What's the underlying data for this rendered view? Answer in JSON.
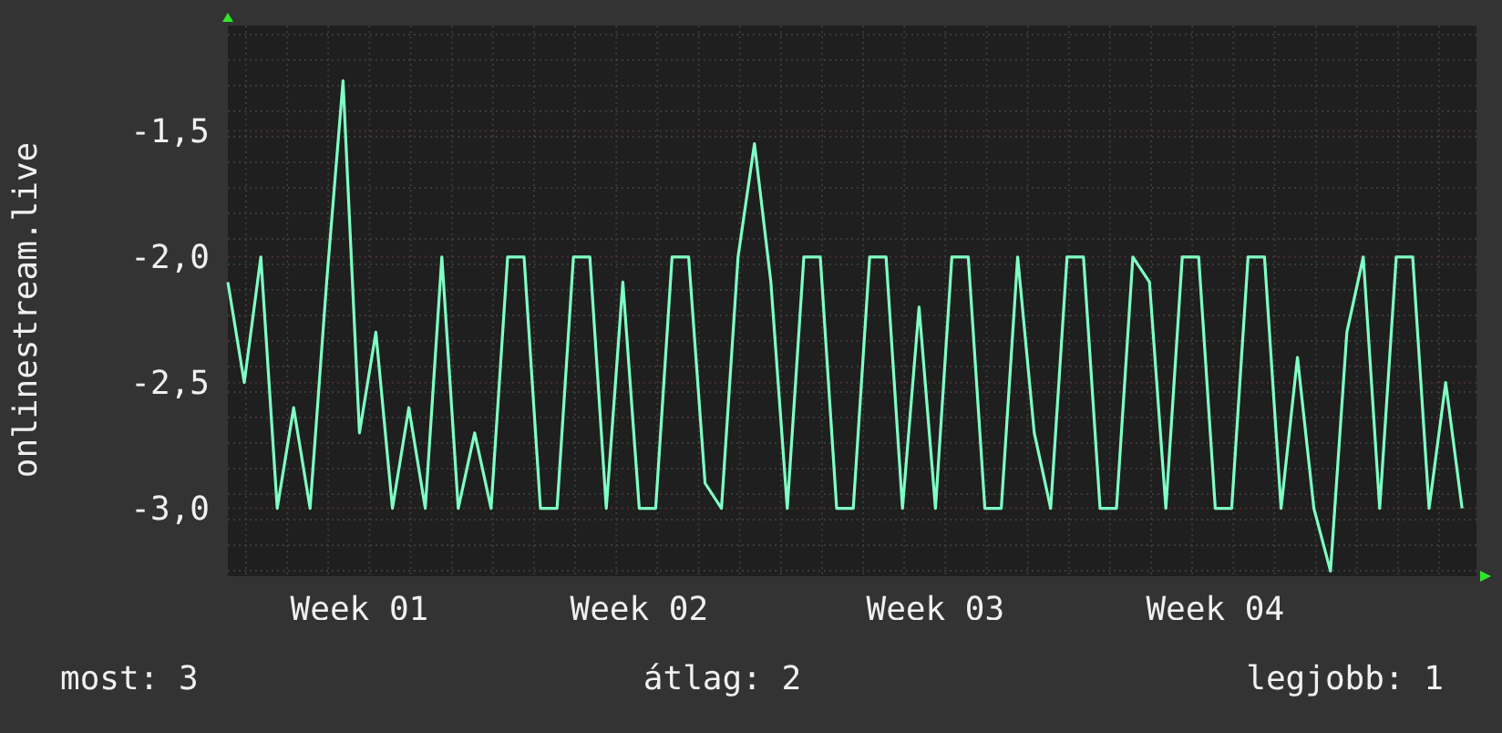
{
  "chart": {
    "chart_data": {
      "type": "line",
      "ylabel": "onlinestream.live",
      "grid": true,
      "ylim": [
        -3.27,
        -1.08
      ],
      "categories": [
        null,
        null,
        null,
        null,
        null,
        null,
        null,
        null,
        "Week 01",
        null,
        null,
        null,
        null,
        null,
        null,
        null,
        null,
        null,
        null,
        null,
        null,
        null,
        null,
        null,
        null,
        "Week 02",
        null,
        null,
        null,
        null,
        null,
        null,
        null,
        null,
        null,
        null,
        null,
        null,
        null,
        null,
        null,
        null,
        null,
        "Week 03",
        null,
        null,
        null,
        null,
        null,
        null,
        null,
        null,
        null,
        null,
        null,
        null,
        null,
        null,
        null,
        null,
        "Week 04",
        null,
        null,
        null,
        null,
        null,
        null,
        null,
        null,
        null,
        null,
        null,
        null,
        null,
        null,
        null
      ],
      "yticks": [
        {
          "value": -1.5,
          "label": "-1,5"
        },
        {
          "value": -2.0,
          "label": "-2,0"
        },
        {
          "value": -2.5,
          "label": "-2,5"
        },
        {
          "value": -3.0,
          "label": "-3,0"
        }
      ],
      "series": [
        {
          "color": "#7fffc4",
          "values": [
            -2.1,
            -2.5,
            -2.0,
            -3.0,
            -2.6,
            -3.0,
            -2.1,
            -1.3,
            -2.7,
            -2.3,
            -3.0,
            -2.6,
            -3.0,
            -2.0,
            -3.0,
            -2.7,
            -3.0,
            -2.0,
            -2.0,
            -3.0,
            -3.0,
            -2.0,
            -2.0,
            -3.0,
            -2.1,
            -3.0,
            -3.0,
            -2.0,
            -2.0,
            -2.9,
            -3.0,
            -2.0,
            -1.55,
            -2.1,
            -3.0,
            -2.0,
            -2.0,
            -3.0,
            -3.0,
            -2.0,
            -2.0,
            -3.0,
            -2.2,
            -3.0,
            -2.0,
            -2.0,
            -3.0,
            -3.0,
            -2.0,
            -2.7,
            -3.0,
            -2.0,
            -2.0,
            -3.0,
            -3.0,
            -2.0,
            -2.1,
            -3.0,
            -2.0,
            -2.0,
            -3.0,
            -3.0,
            -2.0,
            -2.0,
            -3.0,
            -2.4,
            -3.0,
            -3.25,
            -2.3,
            -2.0,
            -3.0,
            -2.0,
            -2.0,
            -3.0,
            -2.5,
            -3.0
          ]
        }
      ]
    }
  },
  "stats": [
    "most: 3",
    "átlag: 2",
    "legjobb: 1"
  ]
}
